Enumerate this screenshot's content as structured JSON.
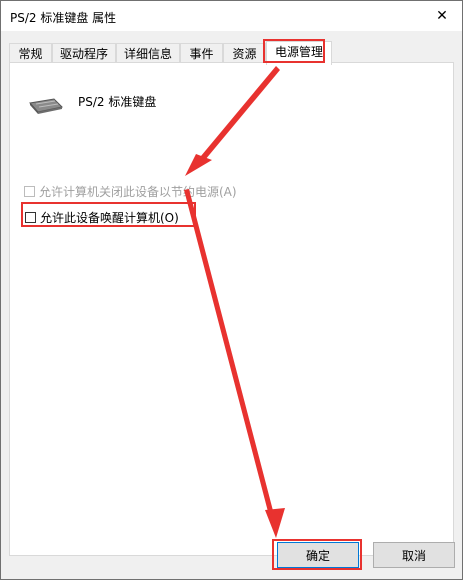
{
  "window": {
    "title": "PS/2 标准键盘 属性",
    "close_glyph": "✕"
  },
  "tabs": [
    {
      "label": "常规"
    },
    {
      "label": "驱动程序"
    },
    {
      "label": "详细信息"
    },
    {
      "label": "事件"
    },
    {
      "label": "资源"
    },
    {
      "label": "电源管理",
      "active": true
    }
  ],
  "device": {
    "name": "PS/2 标准键盘",
    "icon": "keyboard-icon"
  },
  "options": {
    "allow_power_off": {
      "label": "允许计算机关闭此设备以节约电源(A)",
      "checked": false,
      "enabled": false
    },
    "allow_wake": {
      "label": "允许此设备唤醒计算机(O)",
      "checked": false,
      "enabled": true
    }
  },
  "buttons": {
    "ok": "确定",
    "cancel": "取消"
  },
  "colors": {
    "annotation": "#e8322f",
    "accent": "#0078d7"
  }
}
